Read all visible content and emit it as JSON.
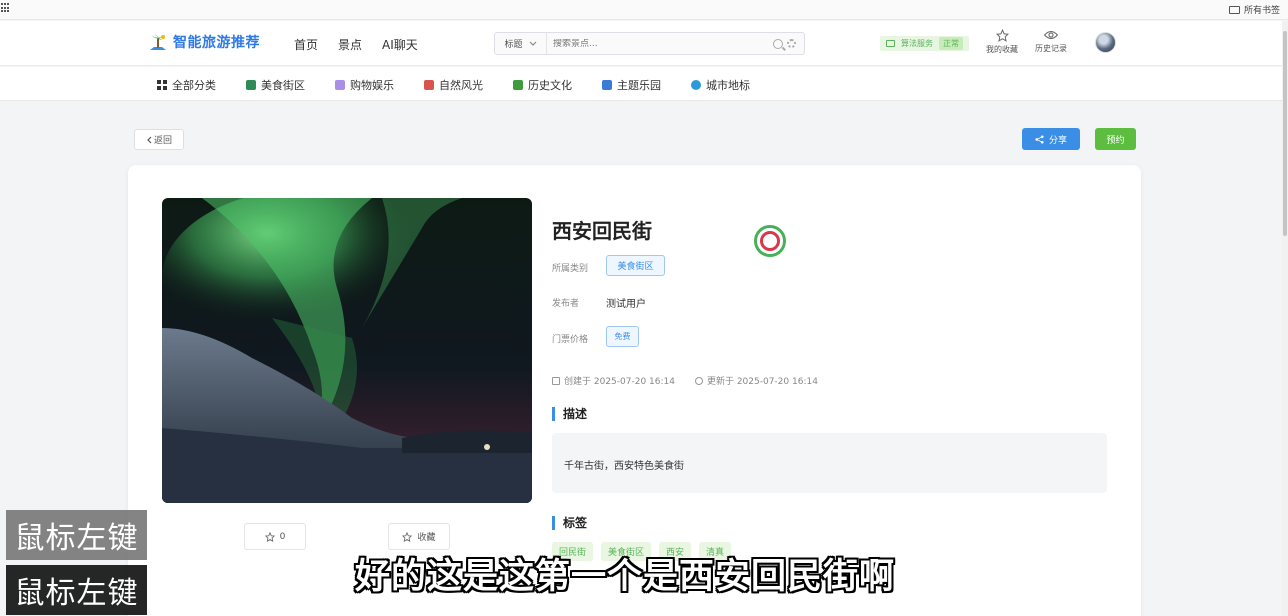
{
  "browser": {
    "bookmarks_folder": "所有书签"
  },
  "header": {
    "logo_text": "智能旅游推荐",
    "nav": [
      "首页",
      "景点",
      "AI聊天"
    ],
    "search": {
      "select_value": "标题",
      "placeholder": "搜索景点..."
    },
    "status": {
      "label": "算法服务",
      "value": "正常"
    },
    "favorites_label": "我的收藏",
    "history_label": "历史记录"
  },
  "categories": [
    {
      "label": "全部分类",
      "color": "#333333"
    },
    {
      "label": "美食街区",
      "color": "#2e8b57"
    },
    {
      "label": "购物娱乐",
      "color": "#7a5bd6"
    },
    {
      "label": "自然风光",
      "color": "#d9534f"
    },
    {
      "label": "历史文化",
      "color": "#3e9b3e"
    },
    {
      "label": "主题乐园",
      "color": "#3a7bd5"
    },
    {
      "label": "城市地标",
      "color": "#2a9bd8"
    }
  ],
  "page": {
    "back_label": "返回",
    "share_label": "分享",
    "book_label": "预约"
  },
  "detail": {
    "title": "西安回民街",
    "category_label": "所属类别",
    "category_value": "美食街区",
    "publisher_label": "发布者",
    "publisher_value": "测试用户",
    "ticket_label": "门票价格",
    "ticket_value": "免费",
    "created": "创建于 2025-07-20 16:14",
    "updated": "更新于 2025-07-20 16:14",
    "desc_heading": "描述",
    "description": "千年古街，西安特色美食街",
    "tags_heading": "标签",
    "tags": [
      "回民街",
      "美食街区",
      "西安",
      "清真"
    ],
    "like_count": "0",
    "favorite_label": "收藏"
  },
  "overlay": {
    "key_badge_1": "鼠标左键",
    "key_badge_2": "鼠标左键",
    "subtitle": "好的这是这第一个是西安回民街啊"
  }
}
